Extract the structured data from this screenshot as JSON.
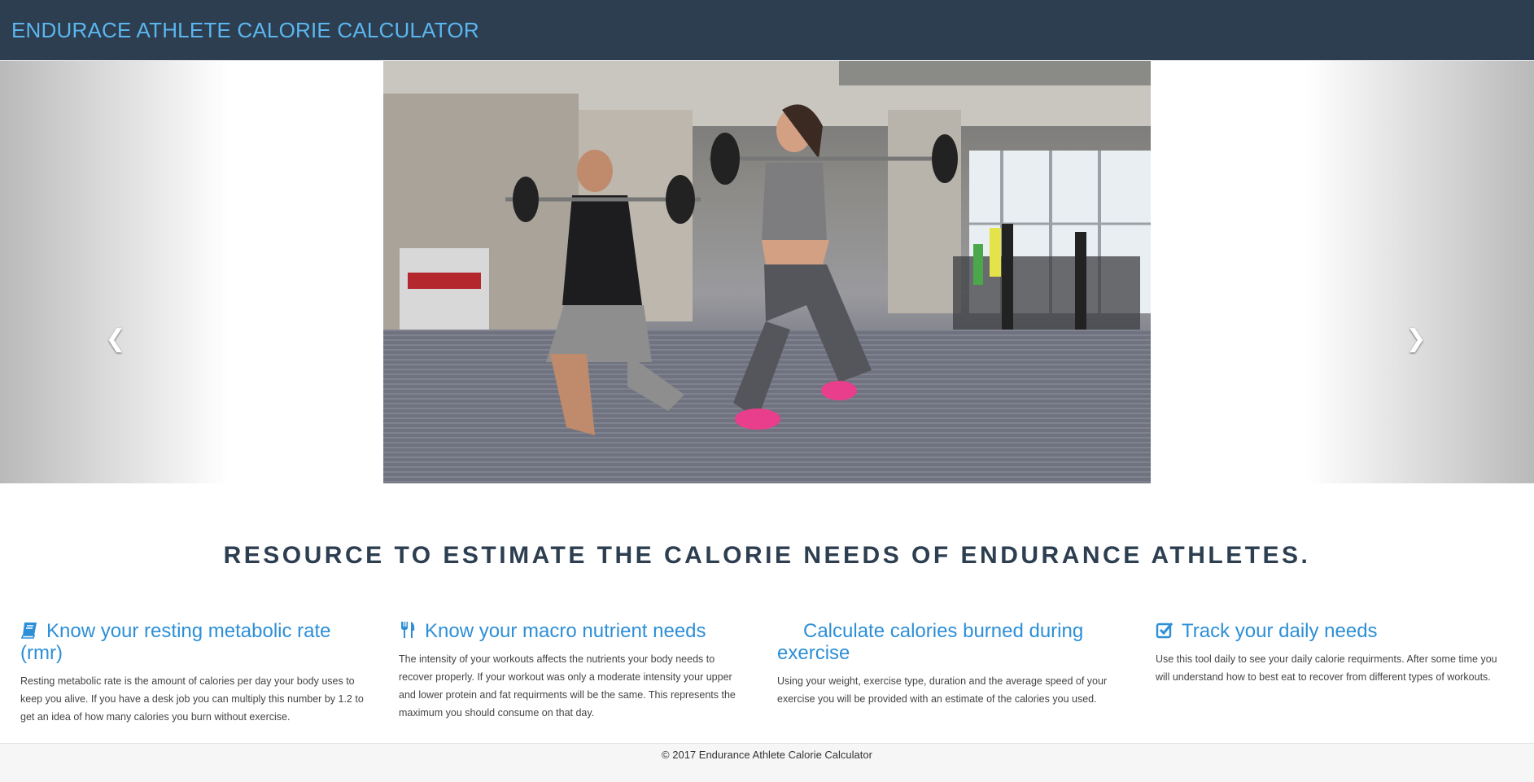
{
  "navbar": {
    "brand": "ENDURACE ATHLETE CALORIE CALCULATOR"
  },
  "carousel": {
    "prev_label": "❮",
    "next_label": "❯",
    "slide_count": 6,
    "active_slide": 5,
    "slide_image": "gym lunges with barbells photo"
  },
  "tagline": "RESOURCE TO ESTIMATE THE CALORIE NEEDS OF ENDURANCE ATHLETES.",
  "features": [
    {
      "icon": "book-icon",
      "title": "Know your resting metabolic rate (rmr)",
      "text": "Resting metabolic rate is the amount of calories per day your body uses to keep you alive. If you have a desk job you can multiply this number by 1.2 to get an idea of how many calories you burn without exercise."
    },
    {
      "icon": "utensils-icon",
      "title": "Know your macro nutrient needs",
      "text": "The intensity of your workouts affects the nutrients your body needs to recover properly. If your workout was only a moderate intensity your upper and lower protein and fat requirments will be the same. This represents the maximum you should consume on that day."
    },
    {
      "icon": "",
      "title": "Calculate calories burned during exercise",
      "text": "Using your weight, exercise type, duration and the average speed of your exercise you will be provided with an estimate of the calories you used."
    },
    {
      "icon": "check-square-icon",
      "title": "Track your daily needs",
      "text": "Use this tool daily to see your daily calorie requirments. After some time you will understand how to best eat to recover from different types of workouts."
    }
  ],
  "footer": {
    "text": "© 2017 Endurance Athlete Calorie Calculator"
  },
  "colors": {
    "navbar": "#2c3e50",
    "brand": "#5bb6ef",
    "accent": "#2d8fd6",
    "tagline": "#2c3e50"
  }
}
